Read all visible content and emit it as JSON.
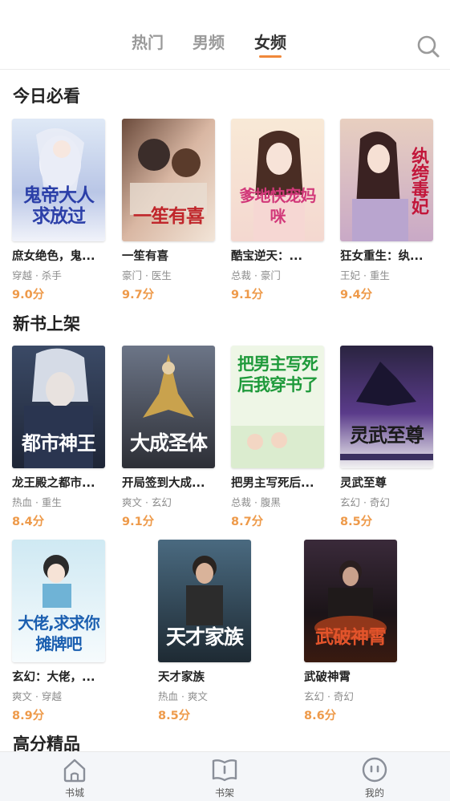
{
  "tabs": {
    "hot": "热门",
    "male": "男频",
    "female": "女频"
  },
  "sections": {
    "today": "今日必看",
    "new_books": "新书上架",
    "high_score": "高分精品"
  },
  "today_books": [
    {
      "title": "庶女绝色，鬼...",
      "tags": "穿越 · 杀手",
      "score": "9.0分",
      "cover_text": "鬼帝大人求放过"
    },
    {
      "title": "一笙有喜",
      "tags": "豪门 · 医生",
      "score": "9.7分",
      "cover_text": "一笙有喜"
    },
    {
      "title": "酷宝逆天：...",
      "tags": "总裁 · 豪门",
      "score": "9.1分",
      "cover_text": "爹地快宠妈咪"
    },
    {
      "title": "狂女重生：纨...",
      "tags": "王妃 · 重生",
      "score": "9.4分",
      "cover_text": "纨绔毒妃"
    }
  ],
  "new_books_row1": [
    {
      "title": "龙王殿之都市...",
      "tags": "热血 · 重生",
      "score": "8.4分",
      "cover_text": "都市神王"
    },
    {
      "title": "开局签到大成...",
      "tags": "爽文 · 玄幻",
      "score": "9.1分",
      "cover_text": "大成圣体"
    },
    {
      "title": "把男主写死后...",
      "tags": "总裁 · 腹黑",
      "score": "8.7分",
      "cover_text": "把男主写死后我穿书了"
    },
    {
      "title": "灵武至尊",
      "tags": "玄幻 · 奇幻",
      "score": "8.5分",
      "cover_text": "灵武至尊"
    }
  ],
  "new_books_row2": [
    {
      "title": "玄幻：大佬，...",
      "tags": "爽文 · 穿越",
      "score": "8.9分",
      "cover_text": "大佬,求求你摊牌吧"
    },
    {
      "title": "天才家族",
      "tags": "热血 · 爽文",
      "score": "8.5分",
      "cover_text": "天才家族"
    },
    {
      "title": "武破神霄",
      "tags": "玄幻 · 奇幻",
      "score": "8.6分",
      "cover_text": "武破神霄"
    }
  ],
  "nav": {
    "bookstore": "书城",
    "bookshelf": "书架",
    "mine": "我的"
  },
  "colors": {
    "accent": "#f0883a",
    "score": "#ee9a4a"
  }
}
